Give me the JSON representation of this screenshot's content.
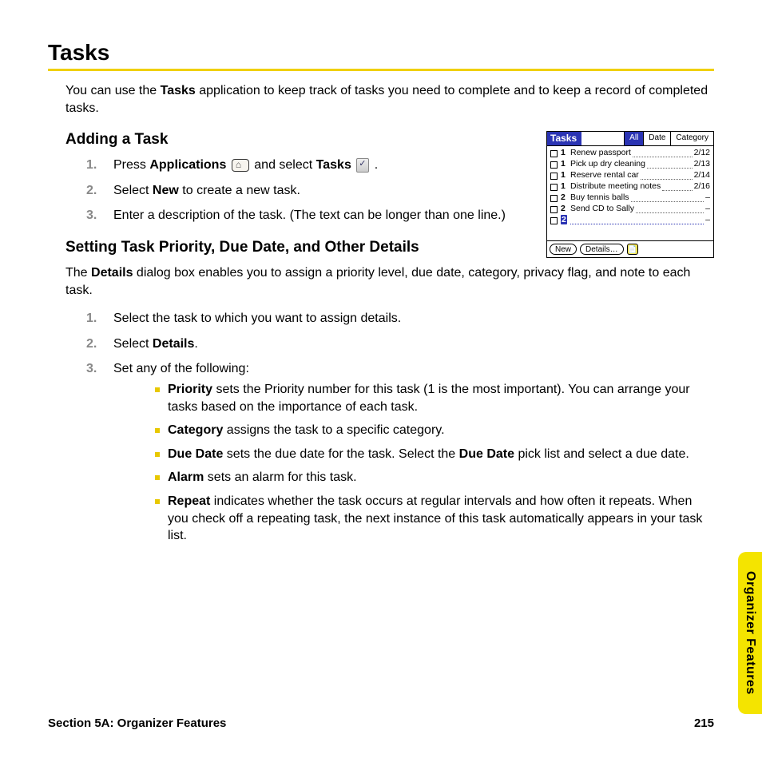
{
  "heading": "Tasks",
  "intro_pre": "You can use the ",
  "intro_bold": "Tasks",
  "intro_post": " application to keep track of tasks you need to complete and to keep a record of completed tasks.",
  "adding": {
    "title": "Adding a Task",
    "step1_a": "Press ",
    "step1_b": "Applications",
    "step1_c": " and select ",
    "step1_d": "Tasks",
    "step1_e": " .",
    "step2_a": "Select ",
    "step2_b": "New",
    "step2_c": " to create a new task.",
    "step3": "Enter a description of the task. (The text can be longer than one line.)"
  },
  "details": {
    "title": "Setting Task Priority, Due Date, and Other Details",
    "para_a": "The ",
    "para_b": "Details",
    "para_c": " dialog box enables you to assign a priority level, due date, category, privacy flag, and note to each task.",
    "step1": "Select the task to which you want to assign details.",
    "step2_a": "Select ",
    "step2_b": "Details",
    "step2_c": ".",
    "step3": "Set any of the following:",
    "bullets": {
      "priority_b": "Priority",
      "priority_t": " sets the Priority number for this task (1 is the most important). You can arrange your tasks based on the importance of each task.",
      "category_b": "Category",
      "category_t": " assigns the task to a specific category.",
      "duedate_b": "Due Date",
      "duedate_t1": " sets the due date for the task. Select the ",
      "duedate_b2": "Due Date",
      "duedate_t2": " pick list and select a due date.",
      "alarm_b": "Alarm",
      "alarm_t": " sets an alarm for this task.",
      "repeat_b": "Repeat",
      "repeat_t": " indicates whether the task occurs at regular intervals and how often it repeats. When you check off a repeating task, the next instance of this task automatically appears in your task list."
    }
  },
  "palm": {
    "title": "Tasks",
    "tabs": {
      "all": "All",
      "date": "Date",
      "category": "Category"
    },
    "rows": [
      {
        "pri": "1",
        "desc": "Renew passport",
        "date": "2/12"
      },
      {
        "pri": "1",
        "desc": "Pick up dry cleaning",
        "date": "2/13"
      },
      {
        "pri": "1",
        "desc": "Reserve rental car",
        "date": "2/14"
      },
      {
        "pri": "1",
        "desc": "Distribute meeting notes",
        "date": "2/16"
      },
      {
        "pri": "2",
        "desc": "Buy tennis balls",
        "date": "–"
      },
      {
        "pri": "2",
        "desc": "Send CD to Sally",
        "date": "–"
      },
      {
        "pri": "2",
        "desc": "",
        "date": "–",
        "selected": true
      }
    ],
    "buttons": {
      "new": "New",
      "details": "Details…"
    }
  },
  "sideTab": "Organizer Features",
  "footer": {
    "section": "Section 5A: Organizer Features",
    "page": "215"
  }
}
